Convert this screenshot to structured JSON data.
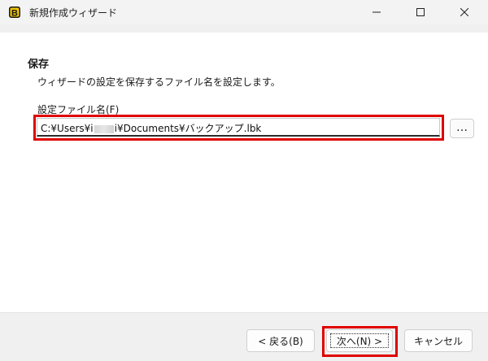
{
  "window": {
    "title": "新規作成ウィザード",
    "app_icon": "backup-app-icon"
  },
  "section": {
    "title": "保存",
    "description": "ウィザードの設定を保存するファイル名を設定します。"
  },
  "file_field": {
    "label": "設定ファイル名(F)",
    "value_prefix": "C:¥Users¥i",
    "value_suffix": "i¥Documents¥バックアップ.lbk",
    "browse_label": "…"
  },
  "buttons": {
    "back": "< 戻る(B)",
    "next": "次へ(N) >",
    "cancel": "キャンセル"
  },
  "colors": {
    "highlight": "#e00000",
    "content_bg": "#ffffff",
    "window_bg": "#f0f0f0"
  }
}
